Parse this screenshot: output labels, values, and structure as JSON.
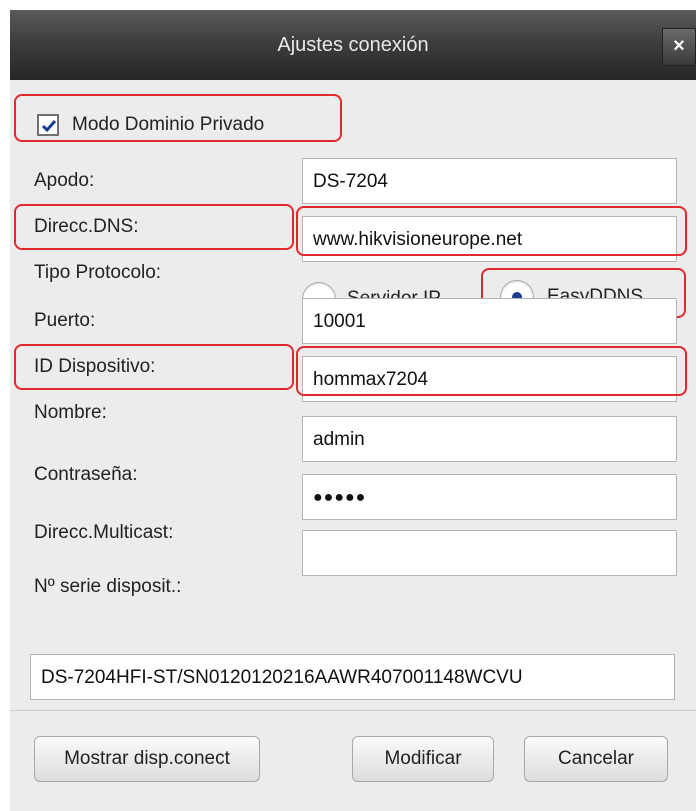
{
  "dialog": {
    "title": "Ajustes conexión",
    "close_glyph": "×"
  },
  "private_domain": {
    "label": "Modo Dominio Privado",
    "checked": true
  },
  "fields": {
    "nickname": {
      "label": "Apodo:",
      "value": "DS-7204"
    },
    "dns": {
      "label": "Direcc.DNS:",
      "value": "www.hikvisioneurope.net"
    },
    "protocol": {
      "label": "Tipo Protocolo:",
      "option_ip": "Servidor IP",
      "option_ddns": "EasyDDNS",
      "selected": "EasyDDNS"
    },
    "port": {
      "label": "Puerto:",
      "value": "10001"
    },
    "device_id": {
      "label": "ID Dispositivo:",
      "value": "hommax7204"
    },
    "username": {
      "label": "Nombre:",
      "value": "admin"
    },
    "password": {
      "label": "Contraseña:",
      "value": "●●●●●"
    },
    "multicast": {
      "label": "Direcc.Multicast:",
      "value": ""
    },
    "serial": {
      "label": "Nº serie disposit.:",
      "value": "DS-7204HFI-ST/SN0120120216AAWR407001148WCVU"
    }
  },
  "buttons": {
    "show": "Mostrar disp.conect",
    "modify": "Modificar",
    "cancel": "Cancelar"
  },
  "colors": {
    "highlight": "#e0282f",
    "titlebar": "#3e3e3e",
    "radio_dot": "#1a3d8f"
  }
}
